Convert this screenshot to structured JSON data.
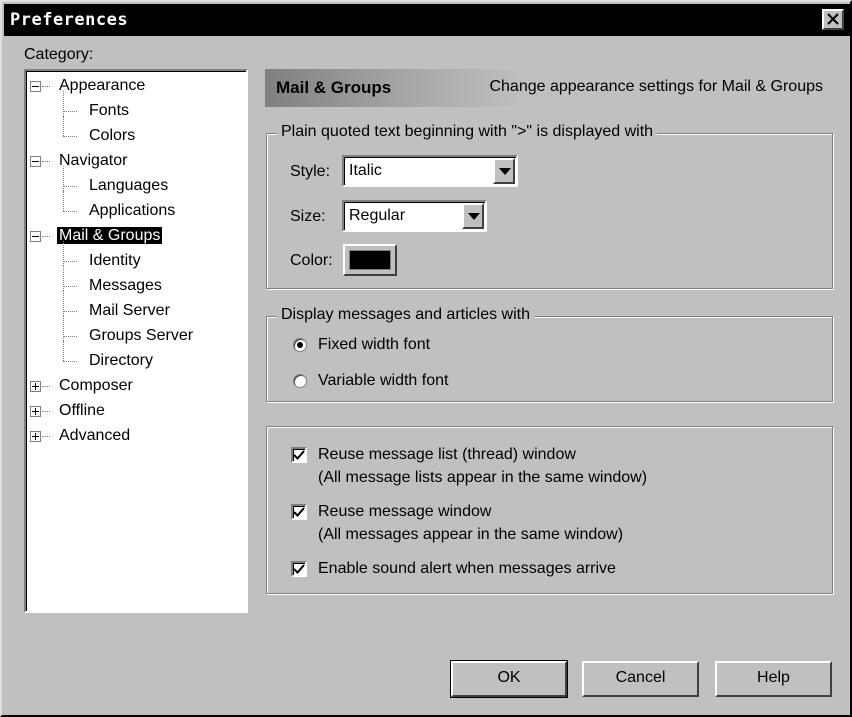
{
  "window": {
    "title": "Preferences"
  },
  "category": {
    "label": "Category:",
    "tree": [
      {
        "label": "Appearance",
        "level": 0,
        "expander": "minus"
      },
      {
        "label": "Fonts",
        "level": 1
      },
      {
        "label": "Colors",
        "level": 1
      },
      {
        "label": "Navigator",
        "level": 0,
        "expander": "minus"
      },
      {
        "label": "Languages",
        "level": 1
      },
      {
        "label": "Applications",
        "level": 1
      },
      {
        "label": "Mail & Groups",
        "level": 0,
        "expander": "minus",
        "selected": true
      },
      {
        "label": "Identity",
        "level": 1
      },
      {
        "label": "Messages",
        "level": 1
      },
      {
        "label": "Mail Server",
        "level": 1
      },
      {
        "label": "Groups Server",
        "level": 1
      },
      {
        "label": "Directory",
        "level": 1
      },
      {
        "label": "Composer",
        "level": 0,
        "expander": "plus"
      },
      {
        "label": "Offline",
        "level": 0,
        "expander": "plus"
      },
      {
        "label": "Advanced",
        "level": 0,
        "expander": "plus"
      }
    ]
  },
  "header": {
    "title": "Mail & Groups",
    "description": "Change appearance settings for Mail & Groups"
  },
  "quoted": {
    "legend": "Plain quoted text beginning with \">\" is displayed with",
    "style_label": "Style:",
    "style_value": "Italic",
    "size_label": "Size:",
    "size_value": "Regular",
    "color_label": "Color:",
    "color_value": "#000000"
  },
  "display": {
    "legend": "Display messages and articles with",
    "fixed_label": "Fixed width font",
    "variable_label": "Variable width font",
    "selected": "fixed"
  },
  "options": {
    "reuse_list_label": "Reuse message list (thread) window",
    "reuse_list_desc": "(All message lists appear in the same window)",
    "reuse_list_checked": true,
    "reuse_window_label": "Reuse message window",
    "reuse_window_desc": "(All messages appear in  the same window)",
    "reuse_window_checked": true,
    "sound_label": "Enable sound alert when messages arrive",
    "sound_checked": true
  },
  "buttons": {
    "ok": "OK",
    "cancel": "Cancel",
    "help": "Help"
  }
}
